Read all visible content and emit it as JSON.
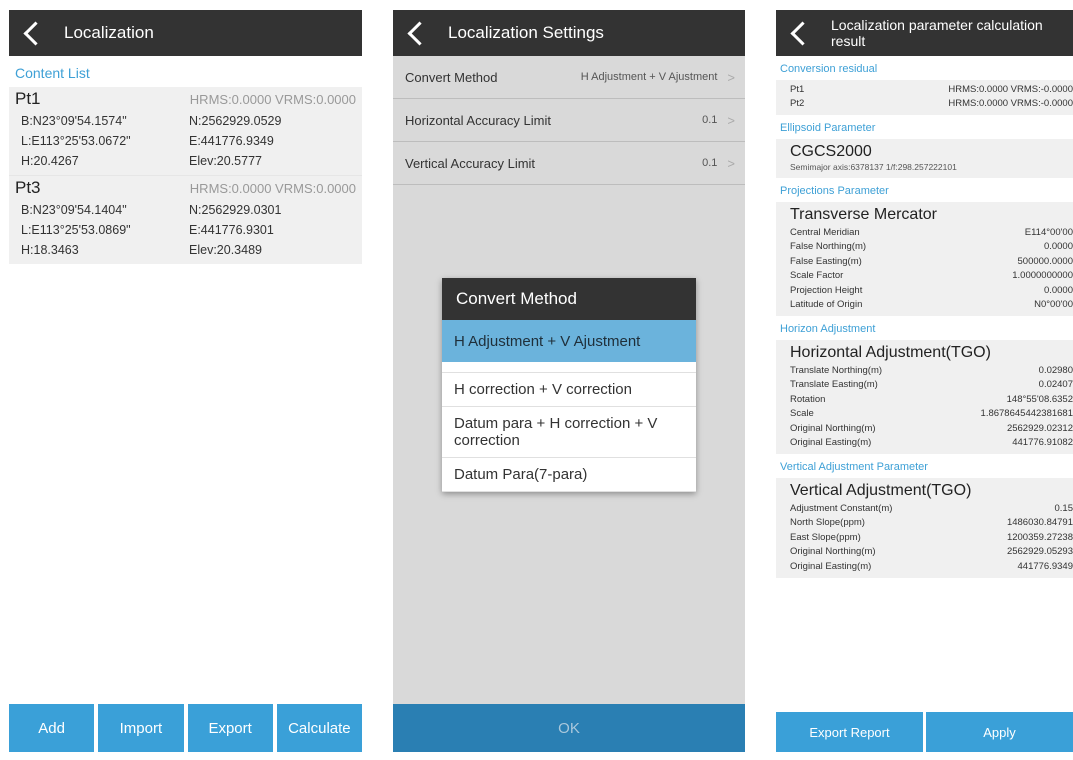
{
  "panel1": {
    "title": "Localization",
    "section": "Content List",
    "points": [
      {
        "name": "Pt1",
        "hv": "HRMS:0.0000 VRMS:0.0000",
        "b": "B:N23°09'54.1574\"",
        "n": "N:2562929.0529",
        "l": "L:E113°25'53.0672\"",
        "e": "E:441776.9349",
        "h": "H:20.4267",
        "elev": "Elev:20.5777"
      },
      {
        "name": "Pt3",
        "hv": "HRMS:0.0000 VRMS:0.0000",
        "b": "B:N23°09'54.1404\"",
        "n": "N:2562929.0301",
        "l": "L:E113°25'53.0869\"",
        "e": "E:441776.9301",
        "h": "H:18.3463",
        "elev": "Elev:20.3489"
      }
    ],
    "buttons": {
      "add": "Add",
      "import": "Import",
      "export": "Export",
      "calculate": "Calculate"
    }
  },
  "panel2": {
    "title": "Localization Settings",
    "rows": [
      {
        "label": "Convert Method",
        "value": "H Adjustment + V Ajustment"
      },
      {
        "label": "Horizontal Accuracy Limit",
        "value": "0.1"
      },
      {
        "label": "Vertical Accuracy Limit",
        "value": "0.1"
      }
    ],
    "dialog": {
      "title": "Convert Method",
      "options": [
        "H Adjustment + V Ajustment",
        "H correction + V correction",
        "Datum para + H correction + V correction",
        "Datum Para(7-para)"
      ]
    },
    "ok": "OK"
  },
  "panel3": {
    "title_line1": "Localization parameter calculation",
    "title_line2": "result",
    "residual": {
      "section": "Conversion residual",
      "rows": [
        {
          "k": "Pt1",
          "v": "HRMS:0.0000 VRMS:-0.0000"
        },
        {
          "k": "Pt2",
          "v": "HRMS:0.0000 VRMS:-0.0000"
        }
      ]
    },
    "ellipsoid": {
      "section": "Ellipsoid Parameter",
      "name": "CGCS2000",
      "detail": "Semimajor axis:6378137  1/f:298.257222101"
    },
    "projection": {
      "section": "Projections Parameter",
      "name": "Transverse Mercator",
      "rows": [
        {
          "k": "Central Meridian",
          "v": "E114°00'00"
        },
        {
          "k": "False Northing(m)",
          "v": "0.0000"
        },
        {
          "k": "False Easting(m)",
          "v": "500000.0000"
        },
        {
          "k": "Scale Factor",
          "v": "1.0000000000"
        },
        {
          "k": "Projection Height",
          "v": "0.0000"
        },
        {
          "k": "Latitude of Origin",
          "v": "N0°00'00"
        }
      ]
    },
    "horizon": {
      "section": "Horizon Adjustment",
      "name": "Horizontal Adjustment(TGO)",
      "rows": [
        {
          "k": "Translate Northing(m)",
          "v": "0.02980"
        },
        {
          "k": "Translate Easting(m)",
          "v": "0.02407"
        },
        {
          "k": "Rotation",
          "v": "148°55'08.6352"
        },
        {
          "k": "Scale",
          "v": "1.8678645442381681"
        },
        {
          "k": "Original Northing(m)",
          "v": "2562929.02312"
        },
        {
          "k": "Original Easting(m)",
          "v": "441776.91082"
        }
      ]
    },
    "vertical": {
      "section": "Vertical Adjustment Parameter",
      "name": "Vertical Adjustment(TGO)",
      "rows": [
        {
          "k": "Adjustment Constant(m)",
          "v": "0.15"
        },
        {
          "k": "North Slope(ppm)",
          "v": "1486030.84791"
        },
        {
          "k": "East Slope(ppm)",
          "v": "1200359.27238"
        },
        {
          "k": "Original Northing(m)",
          "v": "2562929.05293"
        },
        {
          "k": "Original Easting(m)",
          "v": "441776.9349"
        }
      ]
    },
    "buttons": {
      "export_report": "Export Report",
      "apply": "Apply"
    }
  }
}
